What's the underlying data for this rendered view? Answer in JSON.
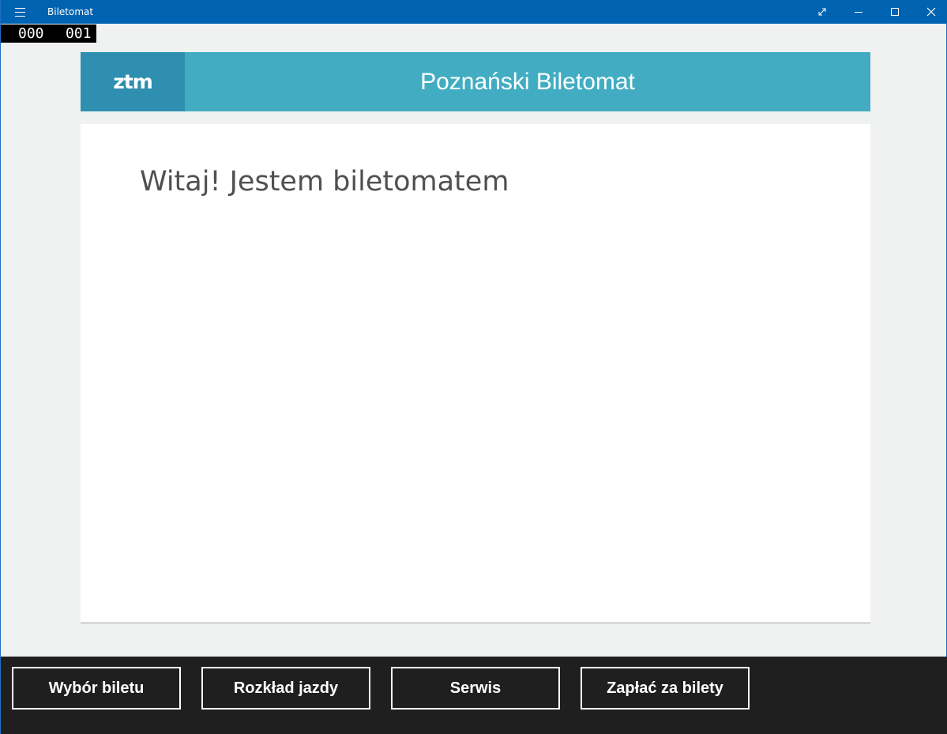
{
  "window": {
    "title": "Biletomat",
    "menu_icon": "hamburger-icon",
    "caption_icons": [
      "fullscreen-icon",
      "minimize-icon",
      "maximize-icon",
      "close-icon"
    ]
  },
  "counter": {
    "left": "000",
    "right": "001"
  },
  "header": {
    "logo_text": "ztm",
    "title": "Poznański Biletomat"
  },
  "content": {
    "welcome": "Witaj! Jestem biletomatem"
  },
  "bottom_nav": [
    {
      "label": "Wybór biletu"
    },
    {
      "label": "Rozkład jazdy"
    },
    {
      "label": "Serwis"
    },
    {
      "label": "Zapłać za bilety"
    }
  ],
  "colors": {
    "titlebar": "#0063b1",
    "header": "#42adc2",
    "logo_bg": "#2e8fb0",
    "bottom_bar": "#1f1f1f"
  }
}
